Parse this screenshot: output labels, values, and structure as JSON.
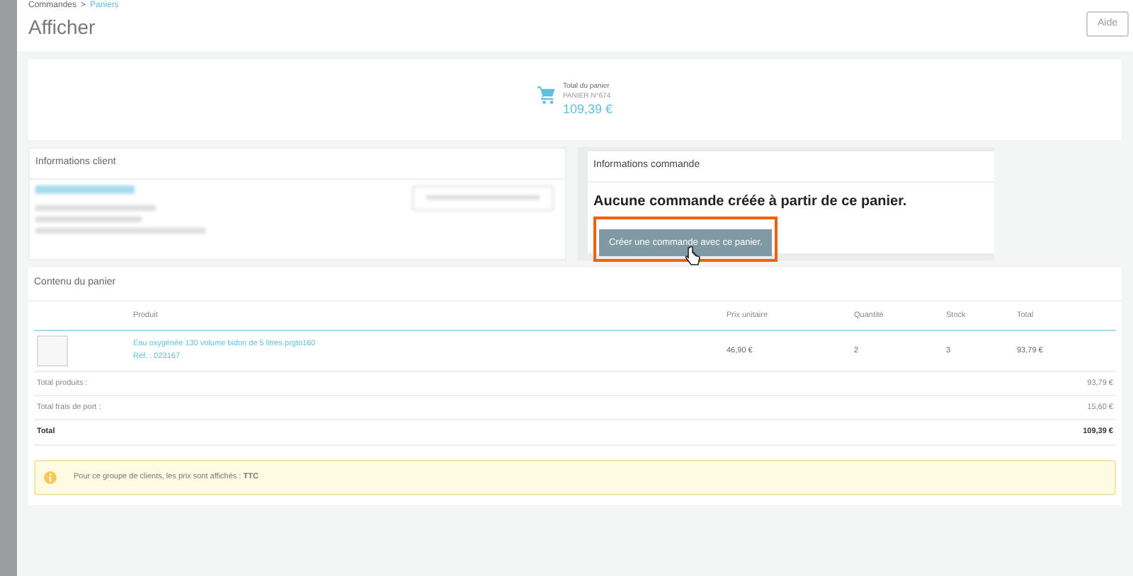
{
  "breadcrumb": {
    "parent": "Commandes",
    "separator": ">",
    "current": "Paniers"
  },
  "title": "Afficher",
  "help_button": "Aide",
  "cart_summary": {
    "label": "Total du panier",
    "number": "PANIER N°674",
    "total": "109,39 €"
  },
  "client_panel": {
    "title": "Informations client"
  },
  "order_panel": {
    "title": "Informations commande",
    "message": "Aucune commande créée à partir de ce panier.",
    "button": "Créer une commande avec ce panier.",
    "highlighted": true
  },
  "cart_contents": {
    "title": "Contenu du panier",
    "columns": [
      "Produit",
      "Prix unitaire",
      "Quantité",
      "Stock",
      "Total"
    ],
    "rows": [
      {
        "name": "Eau oxygénée 130 volume bidon de 5 litres prgto160",
        "ref": "Réf. : 023167",
        "unit_price": "46,90 €",
        "quantity": "2",
        "stock": "3",
        "total": "93,79 €"
      }
    ],
    "totals": [
      {
        "label": "Total produits :",
        "value": "93,79 €",
        "kind": "normal"
      },
      {
        "label": "Total frais de port :",
        "value": "15,60 €",
        "kind": "normal"
      },
      {
        "label": "Total",
        "value": "109,39 €",
        "kind": "grand"
      }
    ],
    "notice": "Pour ce groupe de clients, les prix sont affichés : **TTC**"
  }
}
